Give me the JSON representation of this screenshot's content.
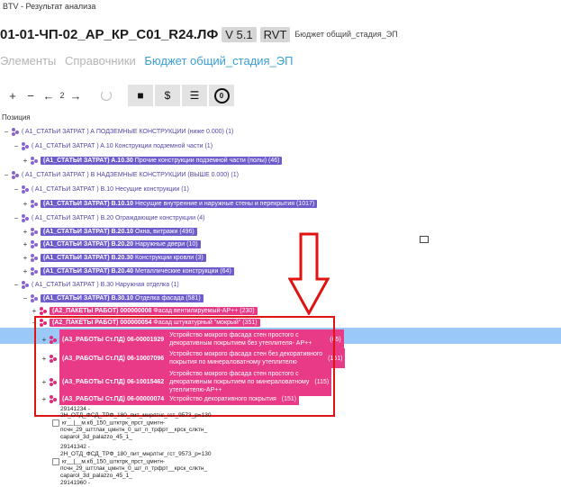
{
  "window": {
    "title": "BTV - Результат анализа"
  },
  "file": {
    "name": "01-01-ЧП-02_АР_КР_С01_R24.ЛФ",
    "version": "V 5.1",
    "format": "RVT",
    "budget": "Бюджет общий_стадия_ЭП"
  },
  "tabs": [
    {
      "label": "Элементы"
    },
    {
      "label": "Справочники"
    },
    {
      "label": "Бюджет общий_стадия_ЭП",
      "active": true
    }
  ],
  "toolbar": {
    "plus": "+",
    "minus": "−",
    "level": "2",
    "currency": "$"
  },
  "tree": {
    "column_header": "Позиция",
    "rows": [
      {
        "toggle": "−",
        "label": "( A1_СТАТЬИ ЗАТРАТ ) A",
        "desc": "ПОДЗЕМНЫЕ КОНСТРУКЦИИ (ниже 0.000)",
        "count": "(1)"
      },
      {
        "toggle": "−",
        "label": "( A1_СТАТЬИ ЗАТРАТ ) A.10",
        "desc": "Конструкции подземной части",
        "count": "(1)"
      },
      {
        "toggle": "+",
        "label": "(A1_СТАТЬИ ЗАТРАТ) A.10.30",
        "desc": "Прочие конструкции подземной части (полы)",
        "count": "(46)"
      },
      {
        "toggle": "−",
        "label": "( A1_СТАТЬИ ЗАТРАТ ) B",
        "desc": "НАДЗЕМНЫЕ КОНСТРУКЦИИ (ВЫШЕ 0.000)",
        "count": "(1)"
      },
      {
        "toggle": "−",
        "label": "( A1_СТАТЬИ ЗАТРАТ ) B.10",
        "desc": "Несущие конструкции",
        "count": "(1)"
      },
      {
        "toggle": "+",
        "label": "(A1_СТАТЬИ ЗАТРАТ) B.10.10",
        "desc": "Несущие внутренние и наружные стены и перекрытия",
        "count": "(1017)"
      },
      {
        "toggle": "−",
        "label": "( A1_СТАТЬИ ЗАТРАТ ) B.20",
        "desc": "Ограждающие конструкции",
        "count": "(4)"
      },
      {
        "toggle": "+",
        "label": "(A1_СТАТЬИ ЗАТРАТ) B.20.10",
        "desc": "Окна, витражи",
        "count": "(496)"
      },
      {
        "toggle": "+",
        "label": "(A1_СТАТЬИ ЗАТРАТ) B.20.20",
        "desc": "Наружные двери",
        "count": "(10)"
      },
      {
        "toggle": "+",
        "label": "(A1_СТАТЬИ ЗАТРАТ) B.20.30",
        "desc": "Конструкции кровли",
        "count": "(3)"
      },
      {
        "toggle": "+",
        "label": "(A1_СТАТЬИ ЗАТРАТ) B.20.40",
        "desc": "Металлические конструкции",
        "count": "(64)"
      },
      {
        "toggle": "−",
        "label": "( A1_СТАТЬИ ЗАТРАТ ) B.30",
        "desc": "Наружная отделка",
        "count": "(1)"
      },
      {
        "toggle": "−",
        "label": "(A1_СТАТЬИ ЗАТРАТ) B.30.10",
        "desc": "Отделка фасада",
        "count": "(581)"
      },
      {
        "toggle": "+",
        "label": "(A2_ПАКЕТЫ РАБОТ) 000000008",
        "desc": "Фасад вентилируемый-АР++",
        "count": "(230)"
      },
      {
        "toggle": "−",
        "label": "(A2_ПАКЕТЫ РАБОТ) 000000054",
        "desc": "Фасад штукатурный \"мокрый\"",
        "count": "(351)"
      }
    ],
    "works": [
      {
        "toggle": "+",
        "code": "(A3_РАБОТЫ Ст.ПД) 06-00001929",
        "desc1": "Устройство мокрого фасада стен простого с",
        "desc2": "декоративным покрытием без утеплителя- АР++",
        "count": "(65)"
      },
      {
        "toggle": "+",
        "code": "(A3_РАБОТЫ Ст.ПД) 06-10007096",
        "desc1": "Устройство мокрого фасада стен без декоративного",
        "desc2": "покрытия по минераловатному утеплителю",
        "count": "(151)"
      },
      {
        "toggle": "+",
        "code": "(A3_РАБОТЫ Ст.ПД) 06-10015462",
        "desc1": "Устройство мокрого фасада стен простого с",
        "desc2": "декоративным покрытием по минераловатному",
        "desc3": "утеплителю-АР++",
        "count": "(115)"
      },
      {
        "toggle": "+",
        "code": "(A3_РАБОТЫ Ст.ПД) 06-00000074",
        "desc1": "Устройство декоративного покрытия",
        "count": "(151)"
      }
    ],
    "elements": [
      {
        "id": "29141234 -",
        "l1": "2Н_ОТД_ФСД_ТРФ_180_пит_мнрлтнг_гст_9573_р=130",
        "l2": "кг__|__м.кб_150_штктрк_прст_цмнтн-",
        "l3": "псчн_29_шттлак_цмнтн_0_шт_п_трфрт__крск_слктн_",
        "l4": "caparol_3d_palazzo_45_1_"
      },
      {
        "id": "29141342 -",
        "l1": "2Н_ОТД_ФСД_ТРФ_180_пит_мнрлтнг_гст_9573_р=130",
        "l2": "кг__|__м.кб_150_штктрк_прст_цмнтн-",
        "l3": "псчн_29_шттлак_цмнтн_0_шт_п_трфрт__крск_слктн_",
        "l4": "caparol_3d_palazzo_45_1_"
      },
      {
        "id": "29141960 -"
      }
    ]
  },
  "colors": {
    "purple_badge": "#6e5ccc",
    "magenta_badge": "#e83a86",
    "selection": "#9ac8f7",
    "annotation_red": "#e01212",
    "accent_tab": "#3aa0d6"
  }
}
